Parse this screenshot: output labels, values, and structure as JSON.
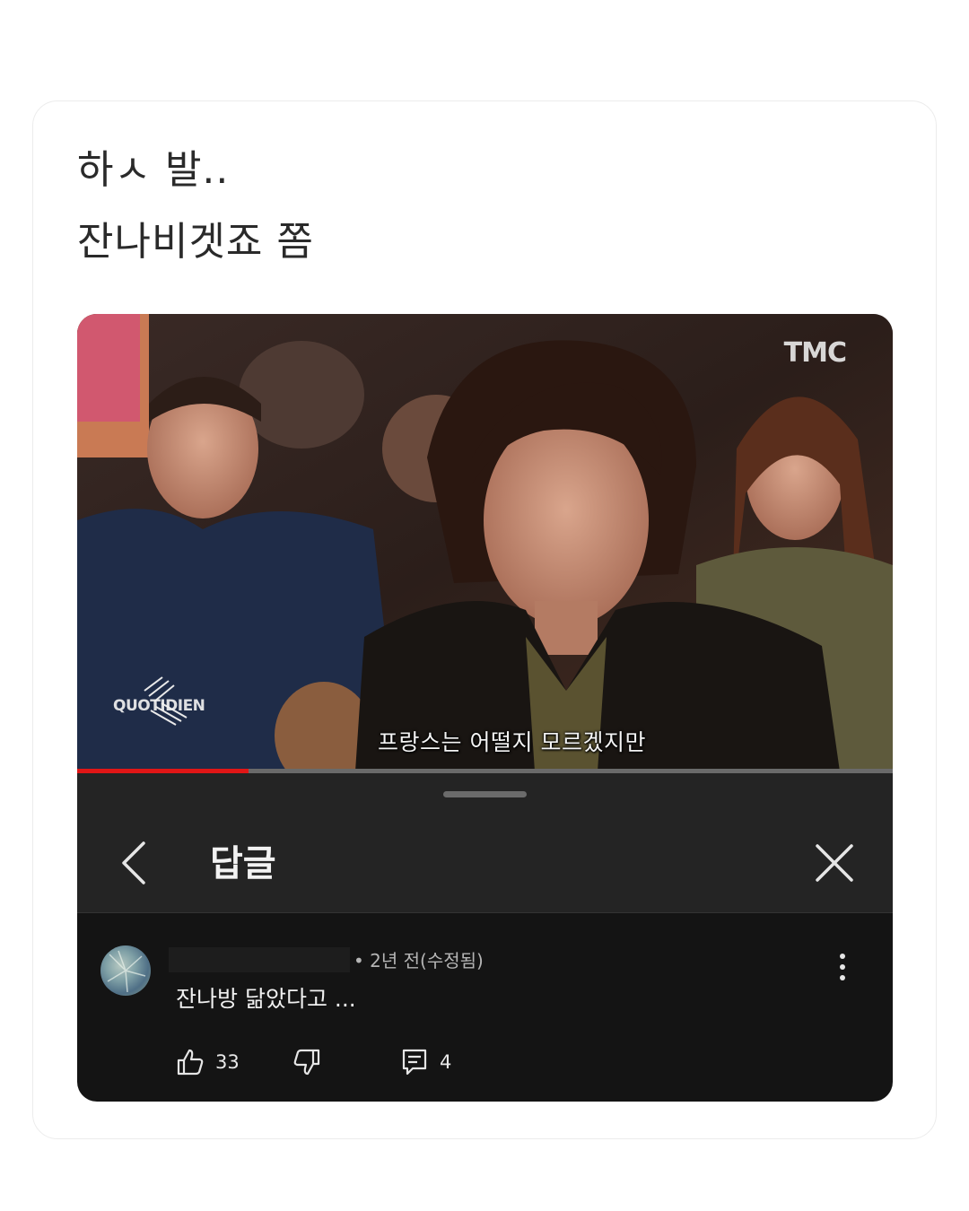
{
  "post": {
    "line1": "하ㅅ 발..",
    "line2": "잔나비겟죠 쫌"
  },
  "video": {
    "channel_logo": "TMC",
    "show_logo": "QUOTIDIEN",
    "subtitle": "프랑스는 어떨지 모르겠지만",
    "progress_fraction": 0.21,
    "progress_color": "#e01616"
  },
  "sheet": {
    "title": "답글",
    "back_icon": "chevron-left-icon",
    "close_icon": "close-icon"
  },
  "comment": {
    "meta": "• 2년 전(수정됨)",
    "text": "잔나방 닮았다고 ...",
    "like_count": "33",
    "reply_count": "4",
    "more_icon": "vertical-ellipsis-icon"
  }
}
